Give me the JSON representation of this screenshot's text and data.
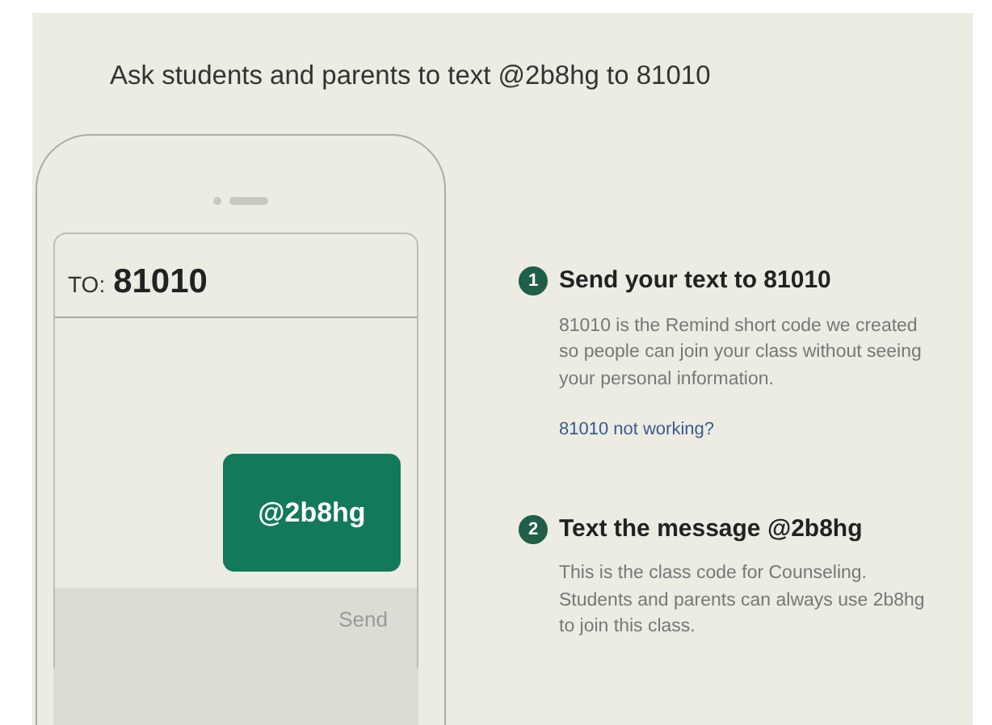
{
  "heading": "Ask students and parents to text @2b8hg to 81010",
  "phone": {
    "to_label": "TO:",
    "to_number": "81010",
    "message": "@2b8hg",
    "send": "Send"
  },
  "steps": [
    {
      "number": "1",
      "title": "Send your text to 81010",
      "text": "81010 is the Remind short code we created so people can join your class without seeing your personal information.",
      "link": "81010 not working?"
    },
    {
      "number": "2",
      "title": "Text the message @2b8hg",
      "text": "This is the class code for Counseling. Students and parents can always use 2b8hg to join this class."
    }
  ]
}
